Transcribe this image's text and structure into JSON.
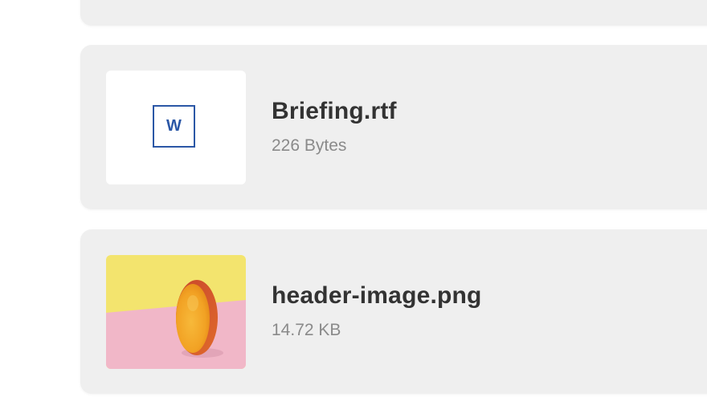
{
  "files": [
    {
      "name": "Briefing.rtf",
      "size": "226 Bytes",
      "icon": "word-document-icon",
      "icon_letter": "W",
      "icon_color": "#2b57a6"
    },
    {
      "name": "header-image.png",
      "size": "14.72 KB",
      "thumbnail": "mango-photo-thumbnail",
      "colors": {
        "top_background": "#f3e46e",
        "bottom_background": "#f1b7c8"
      }
    }
  ]
}
